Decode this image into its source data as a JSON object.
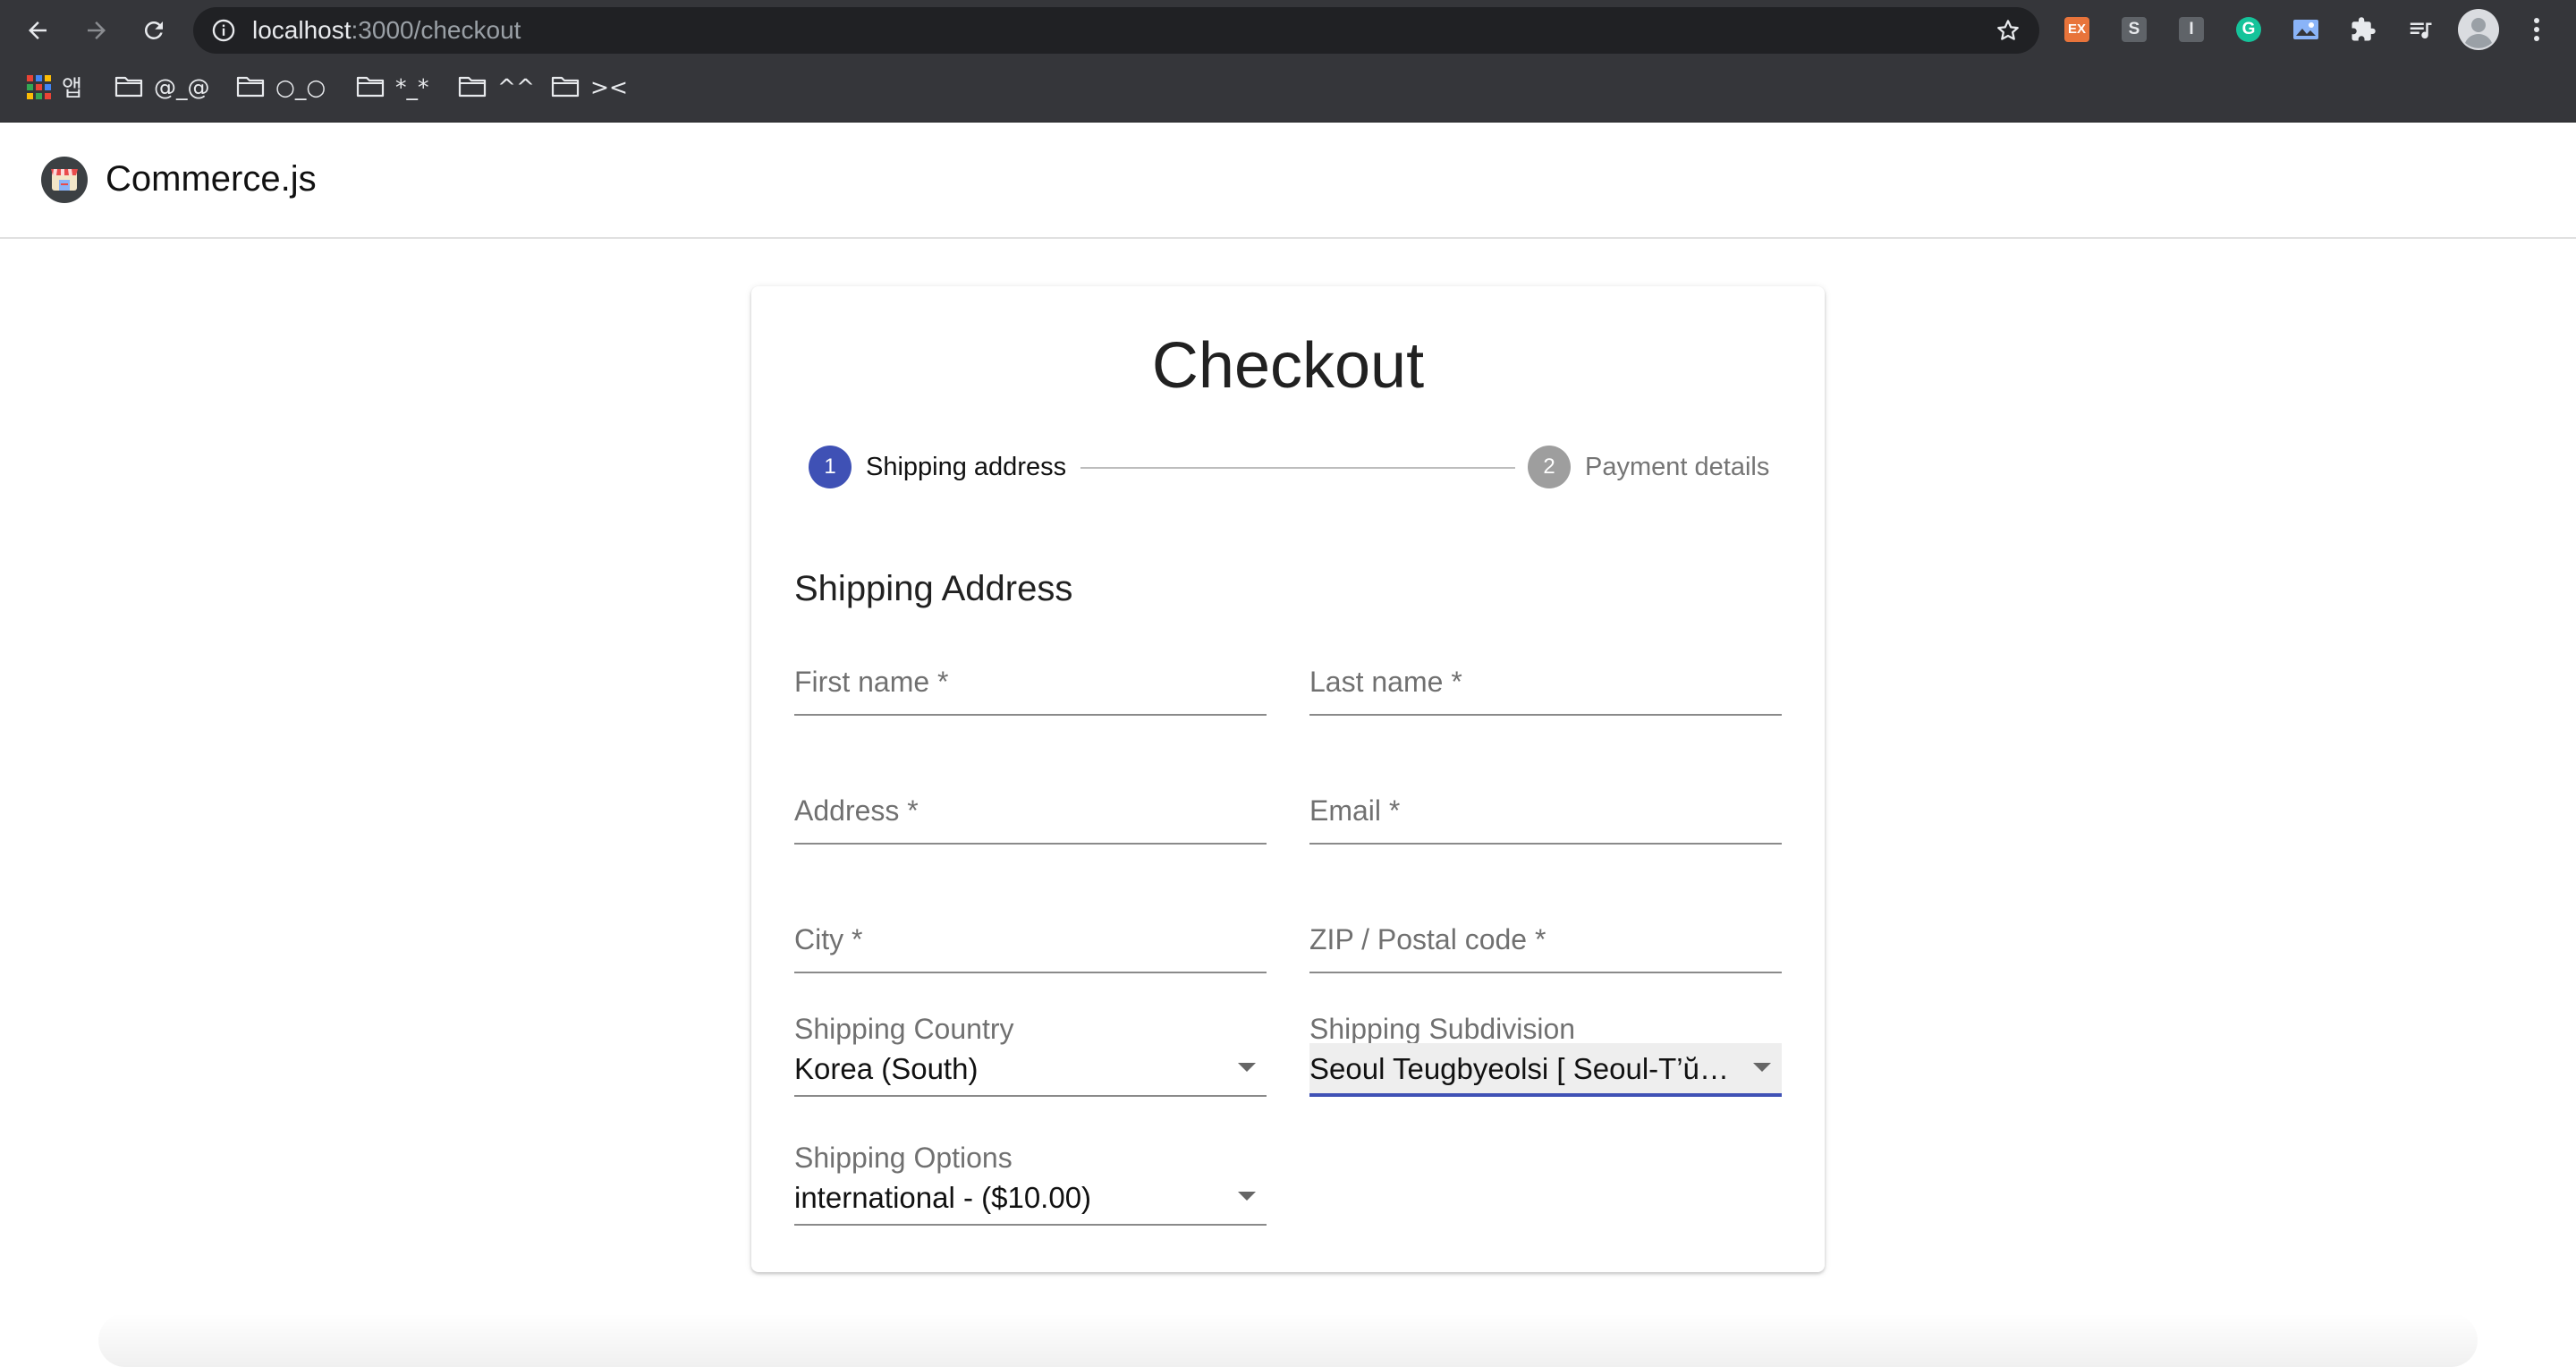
{
  "browser": {
    "url_host": "localhost",
    "url_path": ":3000/checkout",
    "bookmarks": [
      {
        "label": "앱",
        "icon": "apps-grid-icon"
      },
      {
        "label": "@_@",
        "icon": "folder-icon"
      },
      {
        "label": "○_○",
        "icon": "folder-icon"
      },
      {
        "label": "*_*",
        "icon": "folder-icon"
      },
      {
        "label": "^^",
        "icon": "folder-icon"
      },
      {
        "label": "><",
        "icon": "folder-icon"
      }
    ],
    "extensions": [
      {
        "name": "ex-extension-icon",
        "text": "EX",
        "color": "#e8743b"
      },
      {
        "name": "s-extension-icon",
        "text": "S",
        "color": "#5f6368"
      },
      {
        "name": "i-extension-icon",
        "text": "I",
        "color": "#5f6368"
      },
      {
        "name": "grammarly-icon",
        "text": "G",
        "color": "#15c39a"
      }
    ]
  },
  "app": {
    "brand": "Commerce.js"
  },
  "checkout": {
    "title": "Checkout",
    "steps": [
      {
        "number": "1",
        "label": "Shipping address",
        "active": true,
        "color": "#3f51b5"
      },
      {
        "number": "2",
        "label": "Payment details",
        "active": false,
        "color": "#9e9e9e"
      }
    ],
    "section_title": "Shipping Address",
    "fields": {
      "first_name": "First name *",
      "last_name": "Last name *",
      "address": "Address *",
      "email": "Email *",
      "city": "City *",
      "zip": "ZIP / Postal code *"
    },
    "selects": {
      "country": {
        "label": "Shipping Country",
        "value": "Korea (South)"
      },
      "subdivision": {
        "label": "Shipping Subdivision",
        "value": "Seoul Teugbyeolsi [ Seoul-T’ŭkpyŏlshi ]"
      },
      "options": {
        "label": "Shipping Options",
        "value": "international - ($10.00)"
      }
    },
    "accent_color": "#3f51b5"
  }
}
